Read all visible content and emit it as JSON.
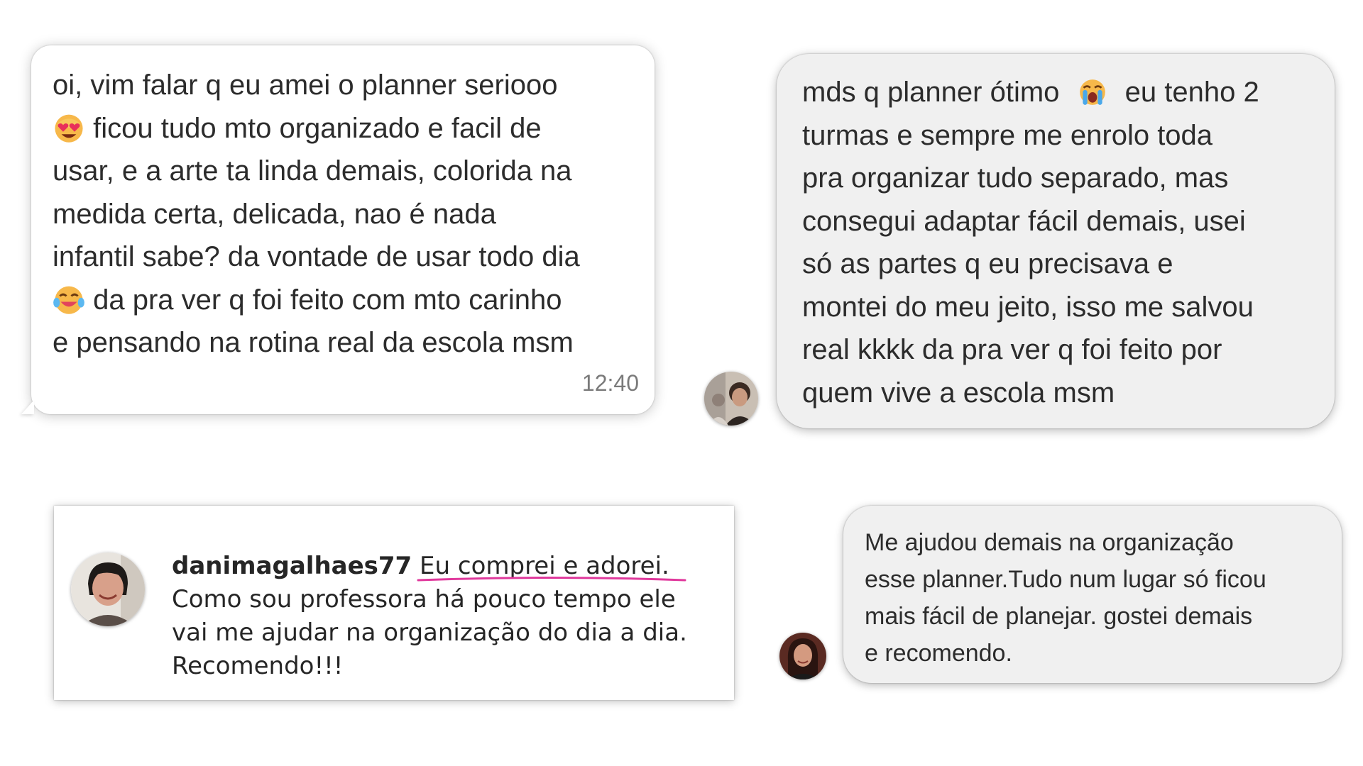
{
  "messages": [
    {
      "lines": [
        "oi, vim falar q eu amei o planner seriooo",
        "ficou tudo mto organizado e facil de",
        "usar, e a arte ta linda demais, colorida na",
        "medida certa, delicada, nao é nada",
        "infantil sabe? da vontade de usar todo dia",
        "da pra ver q foi feito com mto carinho",
        "e pensando na rotina real da escola msm"
      ],
      "emojis": [
        "heart-eyes-emoji",
        "laughing-tears-emoji"
      ],
      "time": "12:40"
    },
    {
      "lines": [
        "mds q planner ótimo",
        "eu tenho 2",
        "turmas e sempre me enrolo toda",
        "pra organizar tudo separado, mas",
        "consegui adaptar fácil demais, usei",
        "só as partes q eu precisava e",
        "montei do meu jeito, isso me salvou",
        "real kkkk da pra ver q foi feito por",
        "quem vive a escola msm"
      ],
      "emojis": [
        "loudly-crying-emoji"
      ]
    },
    {
      "username": "danimagalhaes77",
      "highlight": "Eu comprei e adorei.",
      "lines": [
        "Como sou professora há pouco tempo ele",
        "vai me ajudar na organização do dia a dia.",
        "Recomendo!!!"
      ],
      "underline_color": "#e0389c"
    },
    {
      "lines": [
        "Me ajudou demais na organização",
        "esse planner.Tudo num lugar só ficou",
        "mais fácil de planejar.  gostei demais",
        "e recomendo."
      ]
    }
  ],
  "colors": {
    "bubble_white": "#ffffff",
    "bubble_grey": "#f0f0f0",
    "text": "#2c2c2c",
    "timestamp": "#7a7a7a"
  }
}
